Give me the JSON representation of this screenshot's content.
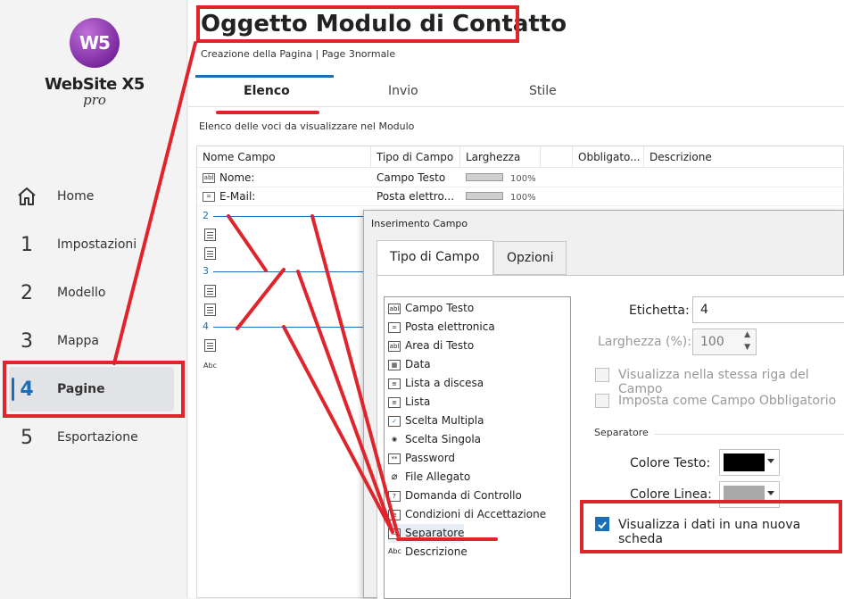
{
  "app": {
    "logo_mark": "W5",
    "logo_name": "WebSite X5",
    "logo_edition": "pro"
  },
  "nav": [
    {
      "num": "",
      "label": "Home",
      "icon": "home-icon"
    },
    {
      "num": "1",
      "label": "Impostazioni"
    },
    {
      "num": "2",
      "label": "Modello"
    },
    {
      "num": "3",
      "label": "Mappa"
    },
    {
      "num": "4",
      "label": "Pagine",
      "active": true
    },
    {
      "num": "5",
      "label": "Esportazione"
    }
  ],
  "header": {
    "title": "Oggetto Modulo di Contatto",
    "breadcrumb": "Creazione della Pagina | Page 3normale"
  },
  "tabs": [
    "Elenco",
    "Invio",
    "Stile"
  ],
  "section_label": "Elenco delle voci da visualizzare nel Modulo",
  "table": {
    "columns": [
      "Nome Campo",
      "Tipo di Campo",
      "Larghezza",
      "Obbligato...",
      "Descrizione"
    ],
    "rows": [
      {
        "icon": "abl",
        "name": "Nome:",
        "type": "Campo Testo",
        "width": "100%",
        "width_fraction": 1.0
      },
      {
        "icon": "mail",
        "name": "E-Mail:",
        "type": "Posta elettro...",
        "width": "100%",
        "width_fraction": 1.0
      }
    ],
    "separators": [
      "2",
      "3",
      "4"
    ],
    "last_icon": "Abc"
  },
  "dialog": {
    "title": "Inserimento Campo",
    "tabs": [
      "Tipo di Campo",
      "Opzioni"
    ],
    "field_types": [
      {
        "icon": "abl",
        "label": "Campo Testo"
      },
      {
        "icon": "mail",
        "label": "Posta elettronica"
      },
      {
        "icon": "abl",
        "label": "Area di Testo"
      },
      {
        "icon": "cal",
        "label": "Data"
      },
      {
        "icon": "list",
        "label": "Lista a discesa"
      },
      {
        "icon": "list",
        "label": "Lista"
      },
      {
        "icon": "check",
        "label": "Scelta Multipla"
      },
      {
        "icon": "radio",
        "label": "Scelta Singola"
      },
      {
        "icon": "**",
        "label": "Password"
      },
      {
        "icon": "clip",
        "label": "File Allegato"
      },
      {
        "icon": "?",
        "label": "Domanda di Controllo"
      },
      {
        "icon": "doc",
        "label": "Condizioni di Accettazione"
      },
      {
        "icon": "sep",
        "label": "Separatore",
        "selected": true
      },
      {
        "icon": "Abc",
        "label": "Descrizione"
      }
    ],
    "options": {
      "label_caption": "Etichetta:",
      "label_value": "4",
      "width_caption": "Larghezza (%):",
      "width_value": "100",
      "same_row": "Visualizza nella stessa riga del Campo",
      "required": "Imposta come Campo Obbligatorio",
      "group": "Separatore",
      "text_color_caption": "Colore Testo:",
      "text_color": "#000000",
      "line_color_caption": "Colore Linea:",
      "line_color": "#a8a8a8",
      "new_tab": "Visualizza i dati in una nuova scheda",
      "new_tab_checked": true
    }
  },
  "colors": {
    "accent": "#1a6fb8",
    "annotation": "#e0242b"
  }
}
